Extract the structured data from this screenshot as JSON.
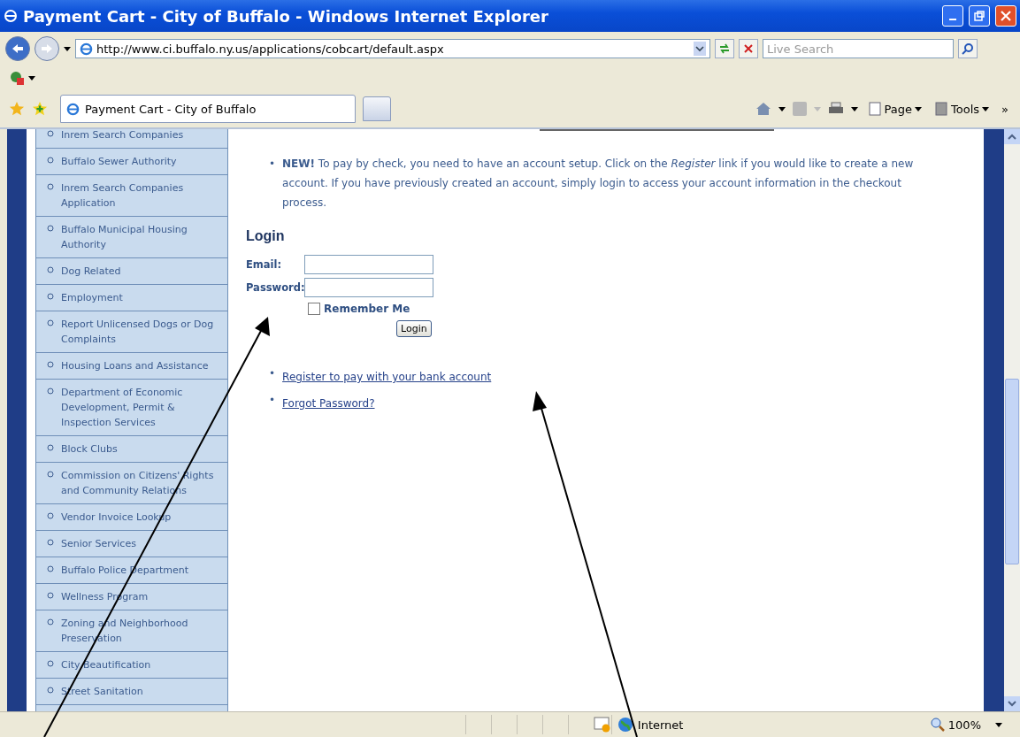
{
  "window": {
    "title": "Payment Cart - City of Buffalo - Windows Internet Explorer"
  },
  "address_bar": {
    "url": "http://www.ci.buffalo.ny.us/applications/cobcart/default.aspx"
  },
  "search": {
    "placeholder": "Live Search"
  },
  "tabs": [
    {
      "label": "Payment Cart - City of Buffalo",
      "selected": true
    }
  ],
  "command_bar": {
    "items": [
      "Page",
      "Tools"
    ],
    "overflow": "»"
  },
  "sidebar": {
    "items": [
      "Inrem Search Companies",
      "Buffalo Sewer Authority",
      "Inrem Search Companies Application",
      "Buffalo Municipal Housing Authority",
      "Dog Related",
      "Employment",
      "Report Unlicensed Dogs or Dog Complaints",
      "Housing Loans and Assistance",
      "Department of Economic Development, Permit & Inspection Services",
      "Block Clubs",
      "Commission on Citizens' Rights and Community Relations",
      "Vendor Invoice Lookup",
      "Senior Services",
      "Buffalo Police Department",
      "Wellness Program",
      "Zoning and Neighborhood Preservation",
      "City Beautification",
      "Street Sanitation"
    ]
  },
  "notice": {
    "bullet": "•",
    "text": "**NEW!** To pay by check, you need to have an account setup. Click on the *Register* link if you would like to create a new account. If you have previously created an account, simply login to access your account information in the checkout process."
  },
  "login": {
    "heading": "Login",
    "fields": [
      {
        "label": "Email:"
      },
      {
        "label": "Password:"
      }
    ],
    "remember": {
      "label": "Remember Me",
      "checked": false
    },
    "button": "Login",
    "links": [
      {
        "bullet": "•",
        "label": "Register to pay with your bank account"
      },
      {
        "bullet": "•",
        "label": "Forgot Password?"
      }
    ]
  },
  "status_bar": {
    "zone": "Internet",
    "zoom": "100%"
  }
}
